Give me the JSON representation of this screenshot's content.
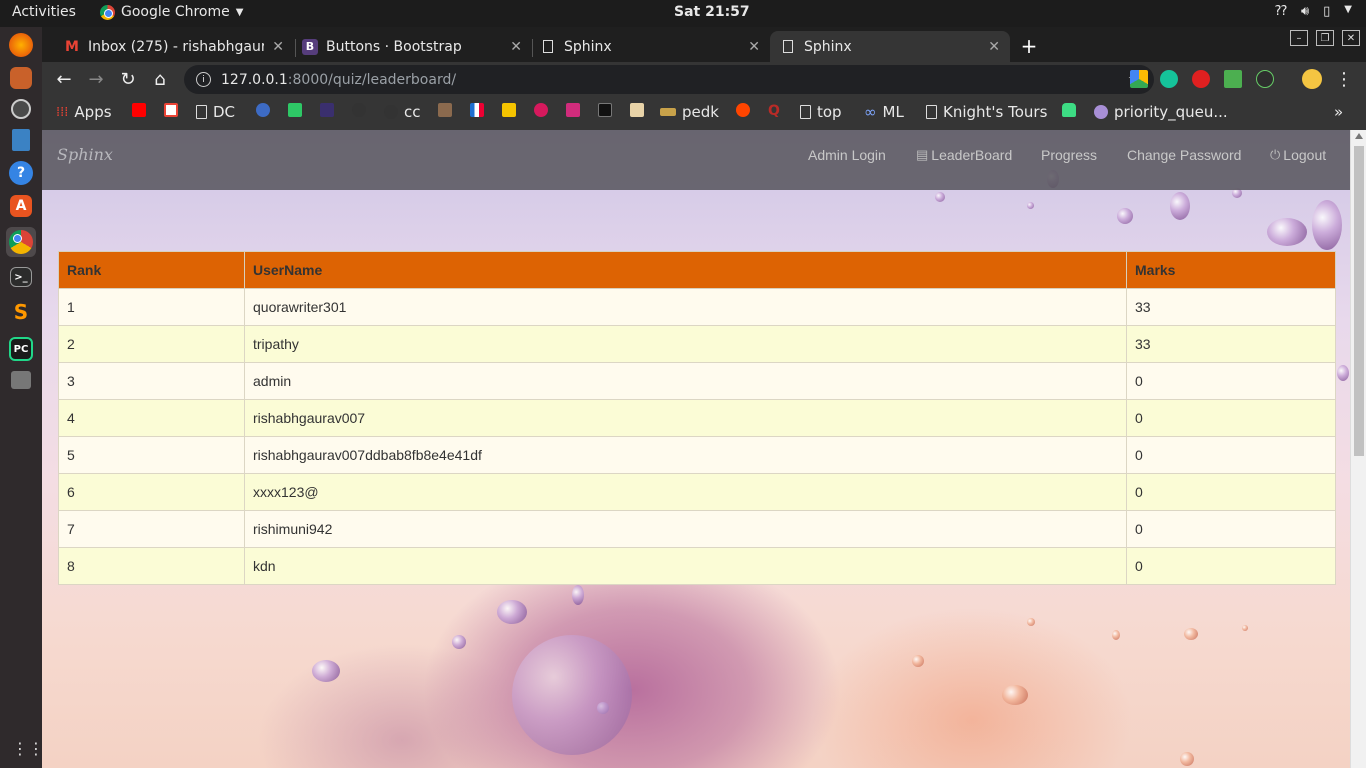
{
  "os": {
    "activities": "Activities",
    "app_menu": "Google Chrome",
    "clock": "Sat 21:57"
  },
  "browser": {
    "tabs": [
      {
        "title": "Inbox (275) - rishabhgaura",
        "favicon": "gmail-icon"
      },
      {
        "title": "Buttons · Bootstrap",
        "favicon": "bootstrap-icon"
      },
      {
        "title": "Sphinx",
        "favicon": "page-icon"
      },
      {
        "title": "Sphinx",
        "favicon": "page-icon",
        "active": true
      }
    ],
    "url_host": "127.0.0.1",
    "url_path": ":8000/quiz/leaderboard/",
    "bookmarks": [
      {
        "label": "Apps",
        "icon": "apps-grid-icon"
      },
      {
        "label": "",
        "icon": "youtube-icon"
      },
      {
        "label": "",
        "icon": "gmail-icon"
      },
      {
        "label": "DC",
        "icon": "page-icon"
      },
      {
        "label": "cc",
        "icon": "github-icon"
      },
      {
        "label": "pedk",
        "icon": "bookmark-icon"
      },
      {
        "label": "top",
        "icon": "page-icon"
      },
      {
        "label": "ML",
        "icon": "infinity-icon"
      },
      {
        "label": "Knight's Tours",
        "icon": "page-icon"
      },
      {
        "label": "priority_queu...",
        "icon": "bookmark-icon"
      }
    ]
  },
  "site": {
    "brand": "Sphinx",
    "nav": {
      "admin_login": "Admin Login",
      "leaderboard": "LeaderBoard",
      "progress": "Progress",
      "change_password": "Change Password",
      "logout": "Logout"
    }
  },
  "leaderboard": {
    "headers": {
      "rank": "Rank",
      "username": "UserName",
      "marks": "Marks"
    },
    "rows": [
      {
        "rank": "1",
        "username": "quorawriter301",
        "marks": "33"
      },
      {
        "rank": "2",
        "username": "tripathy",
        "marks": "33"
      },
      {
        "rank": "3",
        "username": "admin",
        "marks": "0"
      },
      {
        "rank": "4",
        "username": "rishabhgaurav007",
        "marks": "0"
      },
      {
        "rank": "5",
        "username": "rishabhgaurav007ddbab8fb8e4e41df",
        "marks": "0"
      },
      {
        "rank": "6",
        "username": "xxxx123@",
        "marks": "0"
      },
      {
        "rank": "7",
        "username": "rishimuni942",
        "marks": "0"
      },
      {
        "rank": "8",
        "username": "kdn",
        "marks": "0"
      }
    ]
  },
  "colors": {
    "table_header": "#dd6303",
    "row_odd": "#fffbee",
    "row_even": "#fbfcd6",
    "navbar": "#5a5860"
  }
}
